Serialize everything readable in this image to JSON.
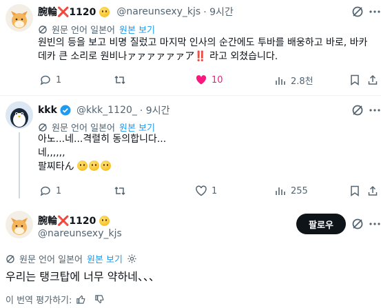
{
  "tweet1": {
    "display_name": "腕輪❌1120",
    "handle": "@nareunsexy_kjs",
    "time": "· 9시간",
    "translate_label": "원문 언어 일본어",
    "view_original": "원본 보기",
    "text_line1": "원빈의 등을 보고 비명 질렀고 마지막 인사의 순간에도 투바를 배웅하고 바로, 바카",
    "text_line2": "데카 큰 소리로 원비나ァァァァァァア",
    "text_exclaim": "‼️",
    "text_line2_end": " 라고 외쳤습니다.",
    "replies": "1",
    "likes": "10",
    "views": "2.8천"
  },
  "tweet2": {
    "display_name": "kkk",
    "handle": "@kkk_1120_",
    "time": "· 9시간",
    "translate_label": "원문 언어 일본어",
    "view_original": "원본 보기",
    "line1": "아노...네...격렬히 동의합니다...",
    "line2": "네,,,,,,",
    "line3": "팔찌타ん",
    "replies": "1",
    "likes": "1",
    "views": "255"
  },
  "tweet3": {
    "display_name": "腕輪❌1120",
    "handle": "@nareunsexy_kjs",
    "follow_label": "팔로우",
    "translate_label": "원문 언어 일본어",
    "view_original": "원본 보기",
    "text": "우리는 탱크탑에 너무 약하네、、、",
    "rate_label": "이 번역 평가하기:"
  },
  "colors": {
    "link": "#1d9bf0",
    "like": "#f91880",
    "text": "#0f1419",
    "muted": "#536471"
  }
}
